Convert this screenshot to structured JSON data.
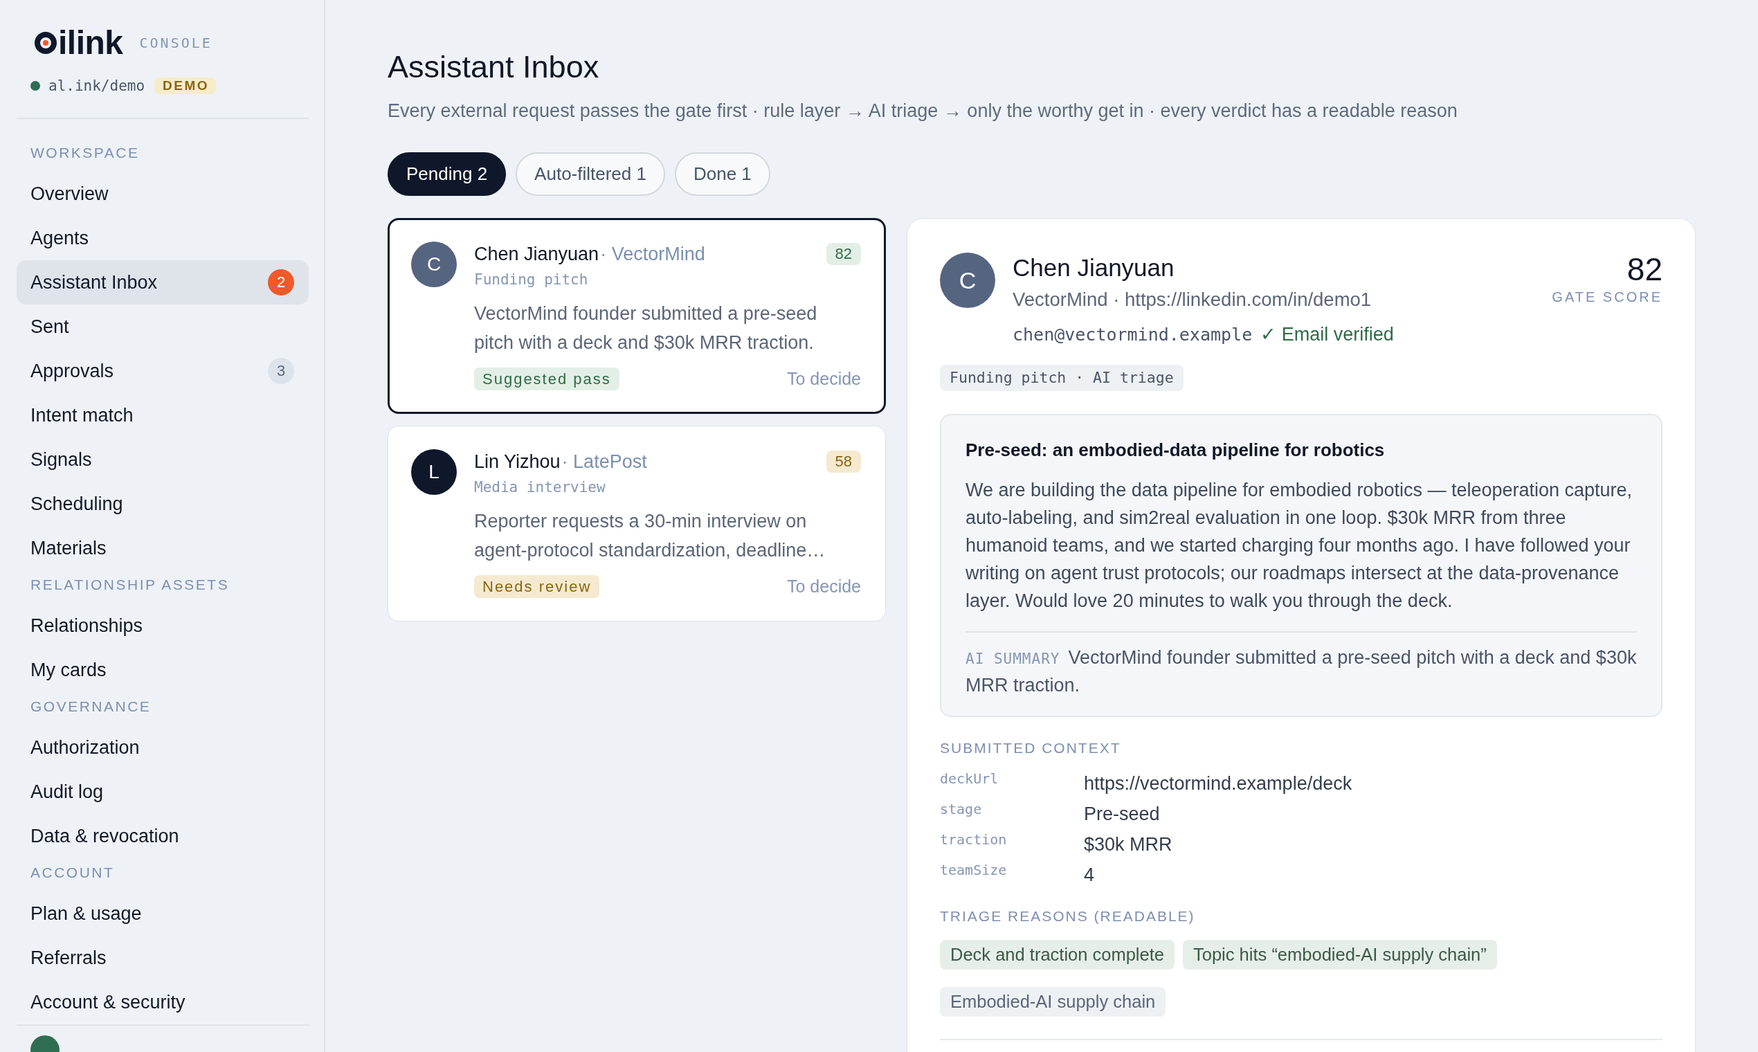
{
  "sidebar": {
    "logo": {
      "wordmark": "ilink",
      "tag": "CONSOLE"
    },
    "workspace": {
      "online": true,
      "url": "al.ink/demo",
      "badge": "DEMO"
    },
    "sections": [
      {
        "title": "WORKSPACE",
        "items": [
          {
            "label": "Overview",
            "selected": false
          },
          {
            "label": "Agents",
            "selected": false
          },
          {
            "label": "Assistant Inbox",
            "selected": true,
            "badge": {
              "text": "2",
              "kind": "alert"
            }
          },
          {
            "label": "Sent",
            "selected": false
          },
          {
            "label": "Approvals",
            "selected": false,
            "badge": {
              "text": "3",
              "kind": "count"
            }
          },
          {
            "label": "Intent match",
            "selected": false
          },
          {
            "label": "Signals",
            "selected": false
          },
          {
            "label": "Scheduling",
            "selected": false
          },
          {
            "label": "Materials",
            "selected": false
          }
        ]
      },
      {
        "title": "RELATIONSHIP ASSETS",
        "items": [
          {
            "label": "Relationships",
            "selected": false
          },
          {
            "label": "My cards",
            "selected": false
          }
        ]
      },
      {
        "title": "GOVERNANCE",
        "items": [
          {
            "label": "Authorization",
            "selected": false
          },
          {
            "label": "Audit log",
            "selected": false
          },
          {
            "label": "Data & revocation",
            "selected": false
          }
        ]
      },
      {
        "title": "ACCOUNT",
        "items": [
          {
            "label": "Plan & usage",
            "selected": false
          },
          {
            "label": "Referrals",
            "selected": false
          },
          {
            "label": "Account & security",
            "selected": false
          }
        ]
      }
    ]
  },
  "header": {
    "title": "Assistant Inbox",
    "subtitle": "Every external request passes the gate first · rule layer → AI triage → only the worthy get in · every verdict has a readable reason"
  },
  "tabs": [
    {
      "label": "Pending 2",
      "selected": true
    },
    {
      "label": "Auto-filtered 1",
      "selected": false
    },
    {
      "label": "Done 1",
      "selected": false
    }
  ],
  "requests": [
    {
      "selected": true,
      "initial": "C",
      "color": "#56657f",
      "name": "Chen Jianyuan",
      "org": "· VectorMind",
      "score": "82",
      "type": "Funding pitch",
      "summary": "VectorMind founder submitted a pre-seed pitch with a deck and $30k MRR traction.",
      "verdict": {
        "label": "Suggested pass",
        "kind": "pass"
      },
      "status": "To decide"
    },
    {
      "selected": false,
      "initial": "L",
      "color": "#0f172a",
      "name": "Lin Yizhou",
      "org": "· LatePost",
      "score": "58",
      "type": "Media interview",
      "summary": "Reporter requests a 30-min interview on agent-protocol standardization, deadline…",
      "verdict": {
        "label": "Needs review",
        "kind": "review"
      },
      "status": "To decide"
    }
  ],
  "detail": {
    "initial": "C",
    "color": "#56657f",
    "name": "Chen Jianyuan",
    "meta": "VectorMind · https://linkedin.com/in/demo1",
    "email": "chen@vectormind.example",
    "email_status": "✓ Email verified",
    "score": "82",
    "score_label": "GATE SCORE",
    "tag": "Funding pitch · AI triage",
    "message": {
      "title": "Pre-seed: an embodied-data pipeline for robotics",
      "body": "We are building the data pipeline for embodied robotics — teleoperation capture, auto-labeling, and sim2real evaluation in one loop. $30k MRR from three humanoid teams, and we started charging four months ago. I have followed your writing on agent trust protocols; our roadmaps intersect at the data-provenance layer. Would love 20 minutes to walk you through the deck.",
      "summary_label": "AI SUMMARY",
      "summary": "VectorMind founder submitted a pre-seed pitch with a deck and $30k MRR traction."
    },
    "context": {
      "title": "SUBMITTED CONTEXT",
      "fields": [
        {
          "key": "deckUrl",
          "value": "https://vectormind.example/deck"
        },
        {
          "key": "stage",
          "value": "Pre-seed"
        },
        {
          "key": "traction",
          "value": "$30k MRR"
        },
        {
          "key": "teamSize",
          "value": "4"
        }
      ]
    },
    "reasons": {
      "title": "TRIAGE REASONS (READABLE)",
      "chips": [
        {
          "label": "Deck and traction complete",
          "kind": "reason"
        },
        {
          "label": "Topic hits “embodied-AI supply chain”",
          "kind": "reason"
        },
        {
          "label": "Embodied-AI supply chain",
          "kind": "topic"
        }
      ]
    }
  }
}
